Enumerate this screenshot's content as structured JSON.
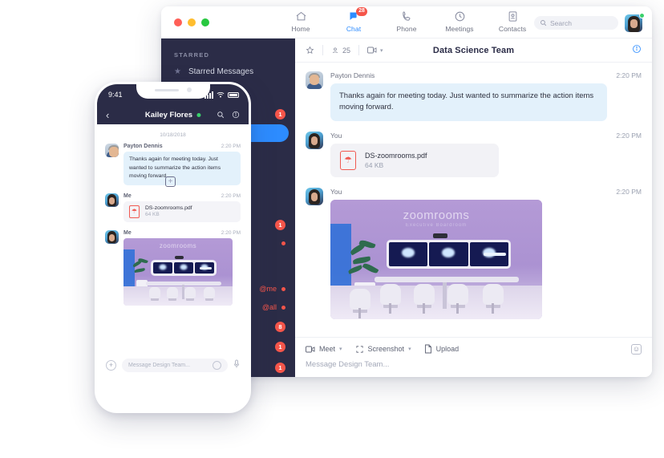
{
  "desktop": {
    "nav": [
      {
        "label": "Home",
        "icon": "home-icon",
        "active": false,
        "badge": ""
      },
      {
        "label": "Chat",
        "icon": "chat-icon",
        "active": true,
        "badge": "28"
      },
      {
        "label": "Phone",
        "icon": "phone-icon",
        "active": false,
        "badge": ""
      },
      {
        "label": "Meetings",
        "icon": "clock-icon",
        "active": false,
        "badge": ""
      },
      {
        "label": "Contacts",
        "icon": "contacts-icon",
        "active": false,
        "badge": ""
      }
    ],
    "search": {
      "placeholder": "Search"
    },
    "sidebar": {
      "section_label": "STARRED",
      "starred_item": "Starred Messages",
      "rows": [
        {
          "badge": "1"
        },
        {
          "badge": ""
        },
        {
          "badge": ""
        },
        {
          "badge": ""
        },
        {
          "badge": "1"
        },
        {
          "badge": "dot"
        },
        {
          "badge": "@me"
        },
        {
          "badge": "@all"
        },
        {
          "badge": "8"
        },
        {
          "badge": "1"
        },
        {
          "badge": "1"
        }
      ]
    },
    "chat_header": {
      "member_count": "25",
      "title": "Data Science Team"
    },
    "messages": [
      {
        "author": "Payton Dennis",
        "time": "2:20 PM",
        "type": "text",
        "text": "Thanks again for meeting today. Just wanted to summarize the action items moving forward."
      },
      {
        "author": "You",
        "time": "2:20 PM",
        "type": "file",
        "file_name": "DS-zoomrooms.pdf",
        "file_size": "64 KB"
      },
      {
        "author": "You",
        "time": "2:20 PM",
        "type": "image",
        "image_caption_primary": "zoom",
        "image_caption_secondary": "rooms",
        "image_caption_sub": "Executive Boardroom"
      }
    ],
    "composer": {
      "meet_label": "Meet",
      "screenshot_label": "Screenshot",
      "upload_label": "Upload",
      "placeholder": "Message Design Team..."
    }
  },
  "phone": {
    "status_time": "9:41",
    "contact_name": "Kailey Flores",
    "date_divider": "10/18/2018",
    "messages": [
      {
        "author": "Payton Dennis",
        "time": "2:20 PM",
        "type": "text",
        "text": "Thanks again for meeting today. Just wanted to summarize the action items moving forward."
      },
      {
        "author": "Me",
        "time": "2:20 PM",
        "type": "file",
        "file_name": "DS-zoomrooms.pdf",
        "file_size": "64 KB"
      },
      {
        "author": "Me",
        "time": "2:20 PM",
        "type": "image"
      }
    ],
    "composer": {
      "placeholder": "Message Design Team..."
    }
  },
  "colors": {
    "accent_blue": "#2d8cff",
    "sidebar_navy": "#2b2c47",
    "badge_red": "#f5554a",
    "bubble_blue": "#e3f1fb",
    "online_green": "#3ad06c"
  }
}
